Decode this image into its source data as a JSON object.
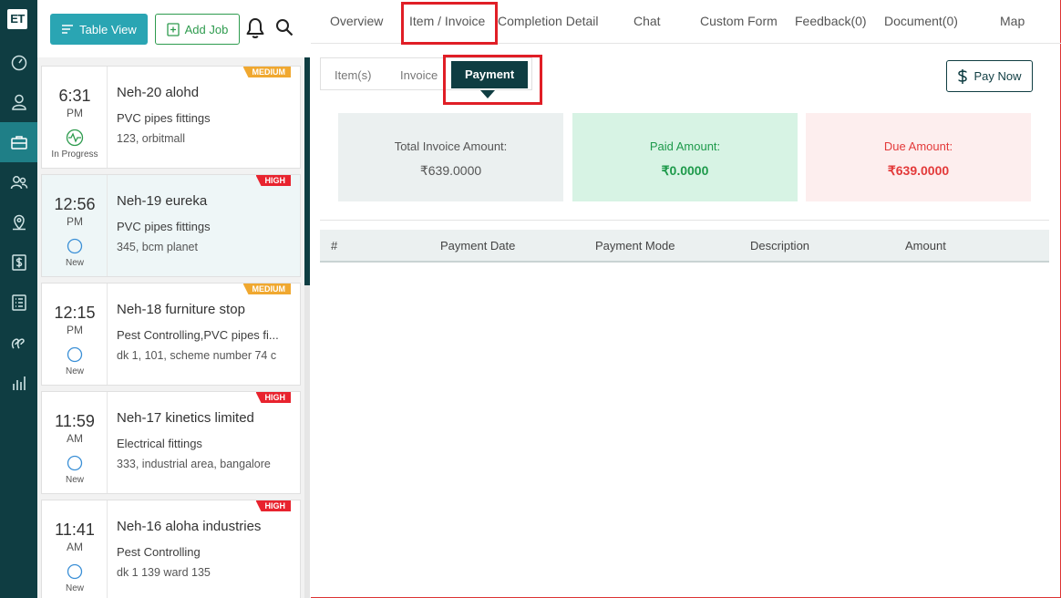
{
  "app": {
    "logo": "ET"
  },
  "rail": {
    "items": [
      "dashboard-icon",
      "user-icon",
      "briefcase-icon",
      "users-icon",
      "map-pin-icon",
      "dollar-icon",
      "list-icon",
      "feedback-icon",
      "bar-chart-icon"
    ],
    "active_index": 2
  },
  "toolbar": {
    "table_view_label": "Table View",
    "add_job_label": "Add Job"
  },
  "jobs": [
    {
      "time": "6:31",
      "ampm": "PM",
      "status": "In Progress",
      "title": "Neh-20 alohd",
      "service": "PVC pipes fittings",
      "address": "123, orbitmall",
      "priority": "MEDIUM"
    },
    {
      "time": "12:56",
      "ampm": "PM",
      "status": "New",
      "title": "Neh-19 eureka",
      "service": "PVC pipes fittings",
      "address": "345, bcm planet",
      "priority": "HIGH"
    },
    {
      "time": "12:15",
      "ampm": "PM",
      "status": "New",
      "title": "Neh-18 furniture stop",
      "service": "Pest Controlling,PVC pipes fi...",
      "address": "dk 1, 101, scheme number 74 c",
      "priority": "MEDIUM"
    },
    {
      "time": "11:59",
      "ampm": "AM",
      "status": "New",
      "title": "Neh-17 kinetics limited",
      "service": "Electrical fittings",
      "address": "333, industrial area, bangalore",
      "priority": "HIGH"
    },
    {
      "time": "11:41",
      "ampm": "AM",
      "status": "New",
      "title": "Neh-16 aloha industries",
      "service": "Pest Controlling",
      "address": "dk 1 139 ward 135",
      "priority": "HIGH"
    }
  ],
  "tabs": {
    "overview": "Overview",
    "item_invoice": "Item / Invoice",
    "completion": "Completion Detail",
    "chat": "Chat",
    "custom_form": "Custom Form",
    "feedback": "Feedback(0)",
    "document": "Document(0)",
    "map": "Map"
  },
  "subtabs": {
    "items": "Item(s)",
    "invoice": "Invoice",
    "payment": "Payment"
  },
  "pay_now_label": "Pay Now",
  "summary": {
    "total_label": "Total Invoice Amount:",
    "total_value": "₹639.0000",
    "paid_label": "Paid Amount:",
    "paid_value": "₹0.0000",
    "due_label": "Due Amount:",
    "due_value": "₹639.0000"
  },
  "table": {
    "headers": [
      "#",
      "Payment Date",
      "Payment Mode",
      "Description",
      "Amount"
    ]
  },
  "colors": {
    "sidebar": "#0f3d42",
    "accent": "#2aa5b3",
    "green": "#2e9b4e",
    "highlight": "#e01e26"
  }
}
